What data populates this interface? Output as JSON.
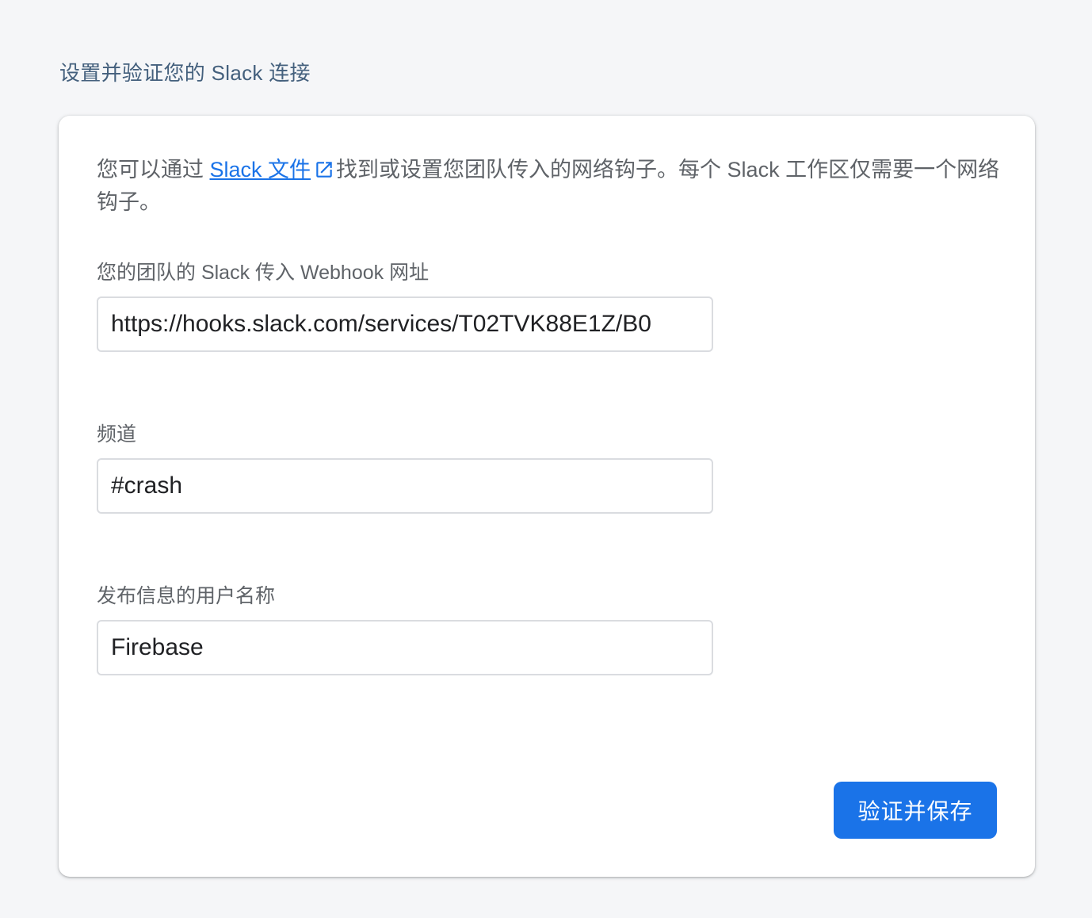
{
  "page": {
    "heading": "设置并验证您的 Slack 连接"
  },
  "card": {
    "description": {
      "before_link": "您可以通过 ",
      "link_label": "Slack 文件",
      "link_icon": "open-in-new-icon",
      "after_link": "找到或设置您团队传入的网络钩子。每个 Slack 工作区仅需要一个网络钩子。"
    },
    "webhook_field": {
      "label": "您的团队的 Slack 传入 Webhook 网址",
      "value": "https://hooks.slack.com/services/T02TVK88E1Z/B0"
    },
    "channel_field": {
      "label": "频道",
      "value": "#crash"
    },
    "username_field": {
      "label": "发布信息的用户名称",
      "value": "Firebase"
    },
    "save_button_label": "验证并保存"
  },
  "colors": {
    "accent": "#1a73e8",
    "background": "#f5f6f8",
    "heading": "#44607d",
    "body_text": "#5f6368"
  }
}
